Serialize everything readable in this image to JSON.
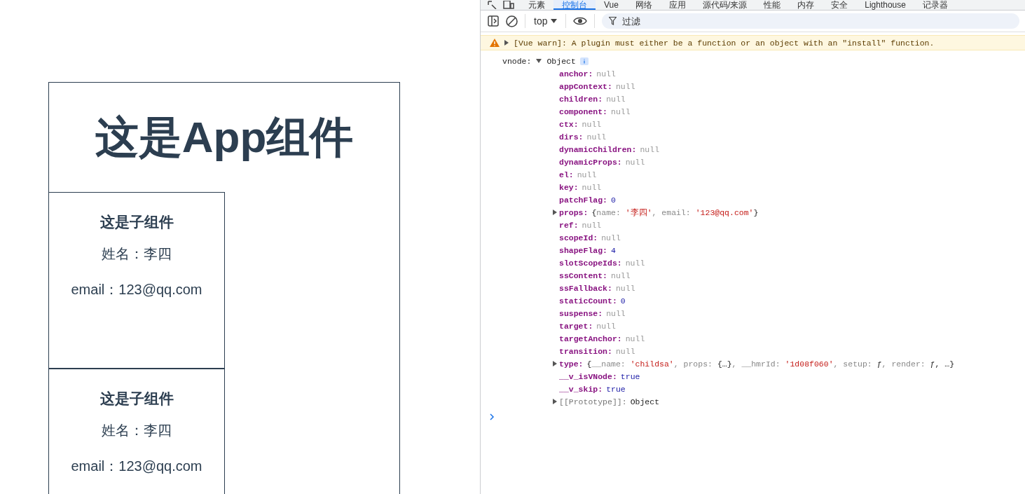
{
  "app": {
    "title": "这是App组件",
    "children": [
      {
        "heading": "这是子组件",
        "name_line": "姓名：李四",
        "email_line": "email：123@qq.com"
      },
      {
        "heading": "这是子组件",
        "name_line": "姓名：李四",
        "email_line": "email：123@qq.com"
      }
    ]
  },
  "devtools": {
    "tabs": [
      {
        "label": "元素",
        "selected": false
      },
      {
        "label": "控制台",
        "selected": true
      },
      {
        "label": "Vue",
        "selected": false
      },
      {
        "label": "网络",
        "selected": false
      },
      {
        "label": "应用",
        "selected": false
      },
      {
        "label": "源代码/来源",
        "selected": false
      },
      {
        "label": "性能",
        "selected": false
      },
      {
        "label": "内存",
        "selected": false
      },
      {
        "label": "安全",
        "selected": false
      },
      {
        "label": "Lighthouse",
        "selected": false
      },
      {
        "label": "记录器",
        "selected": false
      }
    ],
    "toolbar": {
      "context": "top",
      "filter_placeholder": "过滤"
    },
    "warning": {
      "text": "[Vue warn]: A plugin must either be a function or an object with an \"install\" function.",
      "expanded": false
    },
    "log": {
      "label": "vnode:",
      "summary": "Object",
      "expanded": true,
      "properties": [
        {
          "key": "anchor:",
          "kind": "null",
          "value": "null"
        },
        {
          "key": "appContext:",
          "kind": "null",
          "value": "null"
        },
        {
          "key": "children:",
          "kind": "null",
          "value": "null"
        },
        {
          "key": "component:",
          "kind": "null",
          "value": "null"
        },
        {
          "key": "ctx:",
          "kind": "null",
          "value": "null"
        },
        {
          "key": "dirs:",
          "kind": "null",
          "value": "null"
        },
        {
          "key": "dynamicChildren:",
          "kind": "null",
          "value": "null"
        },
        {
          "key": "dynamicProps:",
          "kind": "null",
          "value": "null"
        },
        {
          "key": "el:",
          "kind": "null",
          "value": "null"
        },
        {
          "key": "key:",
          "kind": "null",
          "value": "null"
        },
        {
          "key": "patchFlag:",
          "kind": "number",
          "value": "0"
        },
        {
          "key": "props:",
          "kind": "object",
          "expanded": false,
          "preview": [
            {
              "text": "{",
              "kind": "punct"
            },
            {
              "text": "name: ",
              "kind": "plain"
            },
            {
              "text": "'李四'",
              "kind": "string"
            },
            {
              "text": ", email: ",
              "kind": "plain"
            },
            {
              "text": "'123@qq.com'",
              "kind": "string"
            },
            {
              "text": "}",
              "kind": "punct"
            }
          ]
        },
        {
          "key": "ref:",
          "kind": "null",
          "value": "null"
        },
        {
          "key": "scopeId:",
          "kind": "null",
          "value": "null"
        },
        {
          "key": "shapeFlag:",
          "kind": "number",
          "value": "4"
        },
        {
          "key": "slotScopeIds:",
          "kind": "null",
          "value": "null"
        },
        {
          "key": "ssContent:",
          "kind": "null",
          "value": "null"
        },
        {
          "key": "ssFallback:",
          "kind": "null",
          "value": "null"
        },
        {
          "key": "staticCount:",
          "kind": "number",
          "value": "0"
        },
        {
          "key": "suspense:",
          "kind": "null",
          "value": "null"
        },
        {
          "key": "target:",
          "kind": "null",
          "value": "null"
        },
        {
          "key": "targetAnchor:",
          "kind": "null",
          "value": "null"
        },
        {
          "key": "transition:",
          "kind": "null",
          "value": "null"
        },
        {
          "key": "type:",
          "kind": "object",
          "expanded": false,
          "preview": [
            {
              "text": "{",
              "kind": "punct"
            },
            {
              "text": "__name: ",
              "kind": "plain"
            },
            {
              "text": "'childsa'",
              "kind": "string"
            },
            {
              "text": ", props: ",
              "kind": "plain"
            },
            {
              "text": "{…}",
              "kind": "punct"
            },
            {
              "text": ", __hmrId: ",
              "kind": "plain"
            },
            {
              "text": "'1d08f060'",
              "kind": "string"
            },
            {
              "text": ", setup: ",
              "kind": "plain"
            },
            {
              "text": "ƒ",
              "kind": "punct"
            },
            {
              "text": ", render: ",
              "kind": "plain"
            },
            {
              "text": "ƒ",
              "kind": "punct"
            },
            {
              "text": ",  …}",
              "kind": "punct"
            }
          ]
        },
        {
          "key": "__v_isVNode:",
          "kind": "boolean",
          "value": "true"
        },
        {
          "key": "__v_skip:",
          "kind": "boolean",
          "value": "true"
        },
        {
          "key": "[[Prototype]]:",
          "kind": "prototype",
          "expanded": false,
          "value": "Object"
        }
      ]
    }
  }
}
